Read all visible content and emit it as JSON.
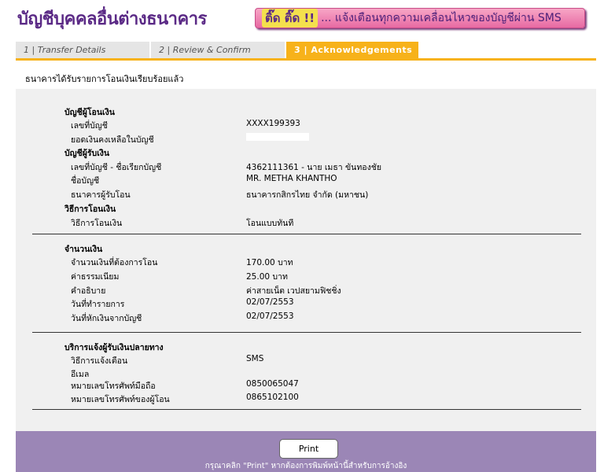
{
  "header": {
    "title": "บัญชีบุคคลอื่นต่างธนาคาร",
    "banner_tick": "ติ๊ด ติ๊ด !!",
    "banner_text": "... แจ้งเตือนทุกความเคลื่อนไหวของบัญชีผ่าน SMS"
  },
  "tabs": [
    {
      "label": "1 | Transfer Details"
    },
    {
      "label": "2 | Review & Confirm"
    },
    {
      "label": "3 | Acknowledgements"
    }
  ],
  "confirm_message": "ธนาคารได้รับรายการโอนเงินเรียบร้อยแล้ว",
  "from_account": {
    "section": "บัญชีผู้โอนเงิน",
    "account_no_label": "เลขที่บัญชี",
    "account_no": "XXXX199393",
    "balance_label": "ยอดเงินคงเหลือในบัญชี"
  },
  "to_account": {
    "section": "บัญชีผู้รับเงิน",
    "account_label": "เลขที่บัญชี - ชื่อเรียกบัญชี",
    "account": "4362111361 - นาย เมธา ขันทองชัย",
    "name_label": "ชื่อบัญชี",
    "name": "MR. METHA KHANTHO",
    "bank_label": "ธนาคารผู้รับโอน",
    "bank": "ธนาคารกสิกรไทย จำกัด (มหาชน)"
  },
  "method": {
    "section": "วิธีการโอนเงิน",
    "label": "วิธีการโอนเงิน",
    "value": "โอนแบบทันที"
  },
  "amount": {
    "section": "จำนวนเงิน",
    "amount_label": "จำนวนเงินที่ต้องการโอน",
    "amount": "170.00 บาท",
    "fee_label": "ค่าธรรมเนียม",
    "fee": "25.00 บาท",
    "desc_label": "คำอธิบาย",
    "desc": "ค่าสายเน็ต เวปสยามฟิชชิ่ง",
    "txn_date_label": "วันที่ทำรายการ",
    "txn_date": "02/07/2553",
    "debit_date_label": "วันที่หักเงินจากบัญชี",
    "debit_date": "02/07/2553"
  },
  "notify": {
    "section": "บริการแจ้งผู้รับเงินปลายทาง",
    "method_label": "วิธีการแจ้งเตือน",
    "method": "SMS",
    "email_label": "อีเมล",
    "mobile_label": "หมายเลขโทรศัพท์มือถือ",
    "mobile": "0850065047",
    "sender_label": "หมายเลขโทรศัพท์ของผู้โอน",
    "sender": "0865102100"
  },
  "footer": {
    "print_label": "Print",
    "note": "กรุณาคลิก \"Print\" หากต้องการพิมพ์หน้านี้สำหรับการอ้างอิง"
  }
}
